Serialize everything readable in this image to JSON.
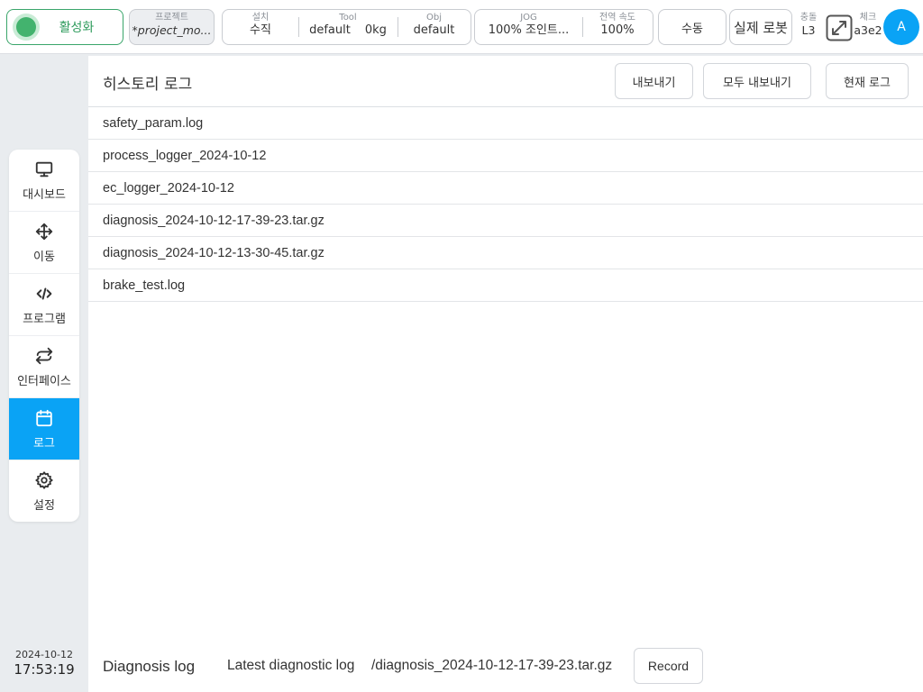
{
  "topbar": {
    "activate_label": "활성화",
    "project_label": "프로젝트",
    "project_value": "*project_mo...",
    "install_label": "설치",
    "install_value": "수직",
    "tool_label": "Tool",
    "tool_name": "default",
    "tool_payload": "0kg",
    "obj_label": "Obj",
    "obj_value": "default",
    "jog_label": "JOG",
    "jog_value": "100%  조인트...",
    "speed_label": "전역 속도",
    "speed_value": "100%",
    "mode_label": "수동",
    "robot_label": "실제 로봇",
    "collision_label": "충돌",
    "collision_value": "L3",
    "check_label": "체크",
    "check_value": "a3e2",
    "avatar_initial": "A",
    "colors": {
      "active_green": "#43b36e",
      "accent_blue": "#0aa3f5"
    }
  },
  "sidebar": {
    "items": [
      {
        "label": "대시보드",
        "icon": "monitor-icon"
      },
      {
        "label": "이동",
        "icon": "move-icon"
      },
      {
        "label": "프로그램",
        "icon": "code-icon"
      },
      {
        "label": "인터페이스",
        "icon": "swap-icon"
      },
      {
        "label": "로그",
        "icon": "calendar-icon",
        "active": true
      },
      {
        "label": "설정",
        "icon": "gear-icon"
      }
    ],
    "date": "2024-10-12",
    "time": "17:53:19"
  },
  "main": {
    "title": "히스토리 로그",
    "buttons": {
      "export": "내보내기",
      "export_all": "모두 내보내기",
      "current_log": "현재 로그"
    },
    "files": [
      "safety_param.log",
      "process_logger_2024-10-12",
      "ec_logger_2024-10-12",
      "diagnosis_2024-10-12-17-39-23.tar.gz",
      "diagnosis_2024-10-12-13-30-45.tar.gz",
      "brake_test.log"
    ],
    "footer": {
      "title": "Diagnosis log",
      "latest_label": "Latest diagnostic log",
      "latest_path": "/diagnosis_2024-10-12-17-39-23.tar.gz",
      "record_label": "Record"
    }
  }
}
